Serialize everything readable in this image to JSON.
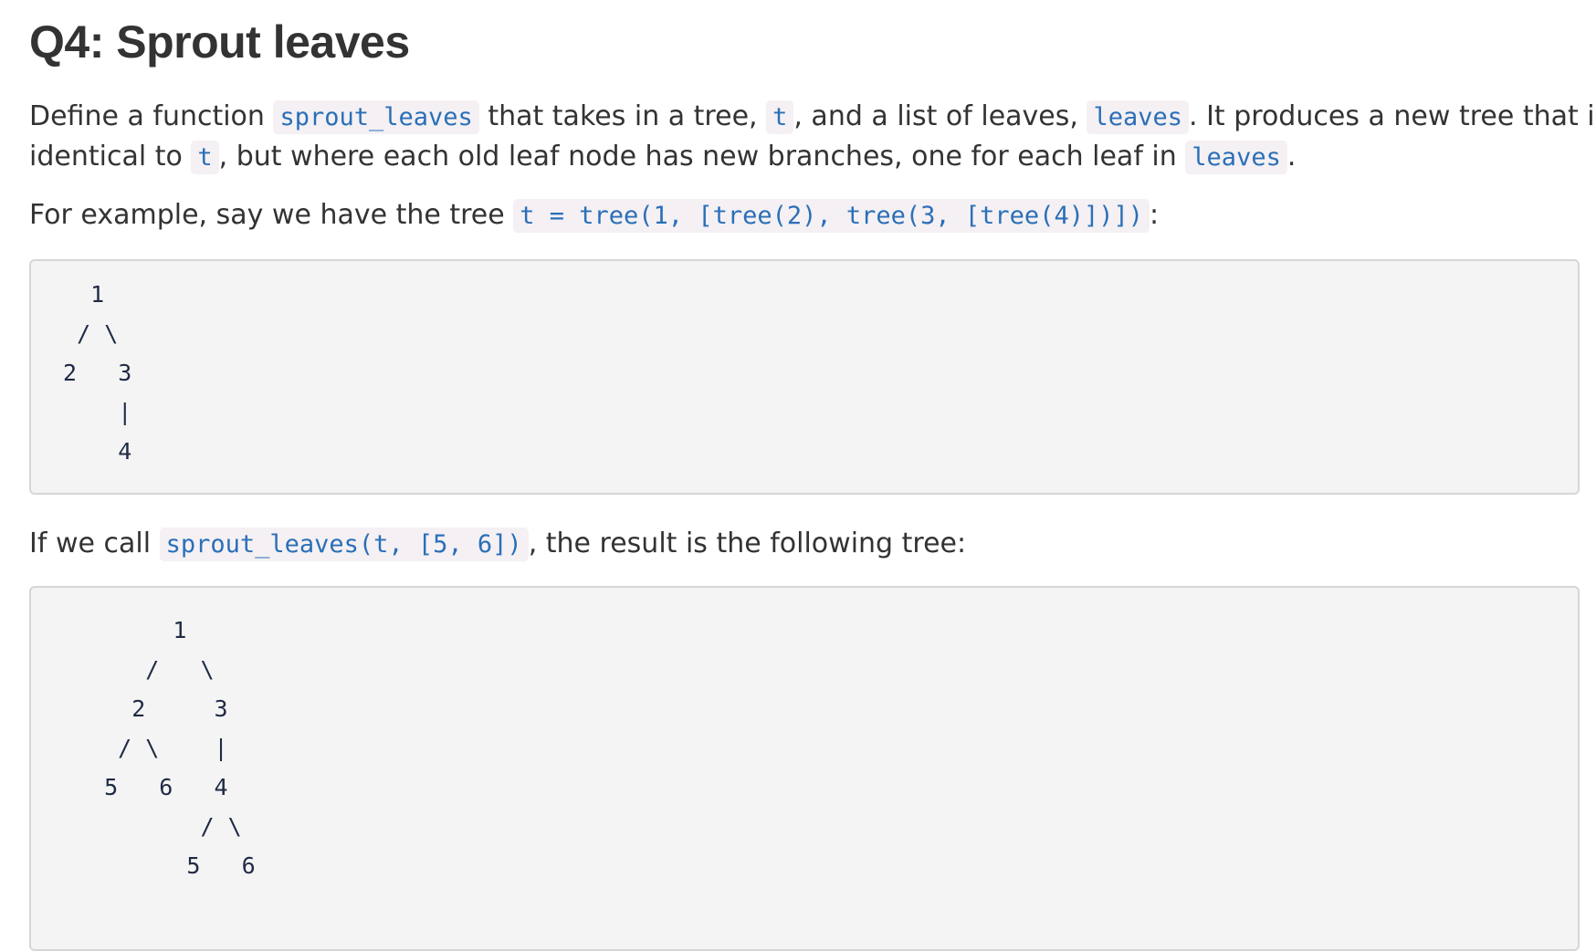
{
  "heading": "Q4: Sprout leaves",
  "paragraph1": {
    "part1": "Define a function ",
    "code1": "sprout_leaves",
    "part2": " that takes in a tree, ",
    "code2": "t",
    "part3": ", and a list of leaves, ",
    "code3": "leaves",
    "part4": ". It produces a new tree that is",
    "part5": "identical to ",
    "code4": "t",
    "part6": ", but where each old leaf node has new branches, one for each leaf in ",
    "code5": "leaves",
    "part7": "."
  },
  "paragraph2": {
    "part1": "For example, say we have the tree ",
    "code1": "t = tree(1, [tree(2), tree(3, [tree(4)])])",
    "part2": ":"
  },
  "code_block_1": "   1\n  / \\\n 2   3\n     |\n     4",
  "paragraph3": {
    "part1": "If we call ",
    "code1": "sprout_leaves(t, [5, 6])",
    "part2": ", the result is the following tree:"
  },
  "code_block_2": "       1\n     /   \\\n    2     3\n   / \\    |\n  5   6   4\n         / \\\n        5   6"
}
